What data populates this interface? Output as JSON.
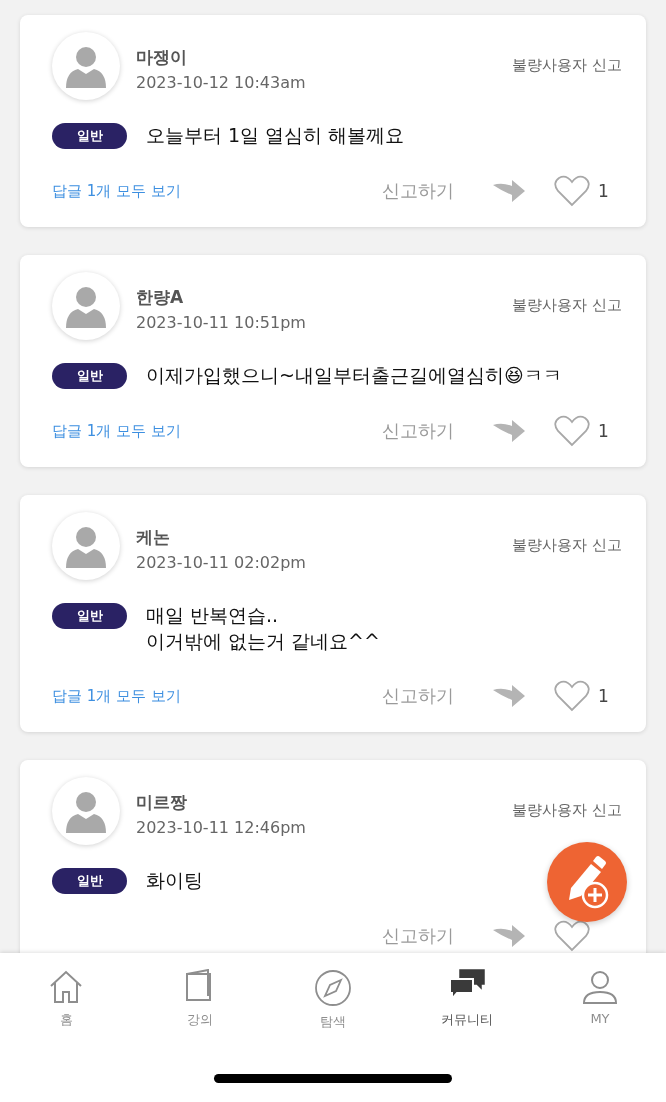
{
  "posts": [
    {
      "author": "마쟁이",
      "time": "2023-10-12 10:43am",
      "report_user": "불량사용자 신고",
      "category": "일반",
      "text": "오늘부터 1일 열심히 해볼께요",
      "replies_link": "답글 1개 모두 보기",
      "report": "신고하기",
      "liked": false,
      "like_count": "1"
    },
    {
      "author": "한량A",
      "time": "2023-10-11 10:51pm",
      "report_user": "불량사용자 신고",
      "category": "일반",
      "text": "이제가입했으니~내일부터출근길에열심히😆ㅋㅋ",
      "replies_link": "답글 1개 모두 보기",
      "report": "신고하기",
      "liked": false,
      "like_count": "1"
    },
    {
      "author": "케논",
      "time": "2023-10-11 02:02pm",
      "report_user": "불량사용자 신고",
      "category": "일반",
      "text": "매일 반복연습..\n이거밖에 없는거 같네요^^",
      "replies_link": "답글 1개 모두 보기",
      "report": "신고하기",
      "liked": false,
      "like_count": "1"
    },
    {
      "author": "미르짱",
      "time": "2023-10-11 12:46pm",
      "report_user": "불량사용자 신고",
      "category": "일반",
      "text": "화이팅",
      "report": "신고하기",
      "liked": false
    }
  ],
  "nav": [
    {
      "kind": "home",
      "label": "홈",
      "selected": false
    },
    {
      "kind": "lecture",
      "label": "강의",
      "selected": false
    },
    {
      "kind": "explore",
      "label": "탐색",
      "selected": false
    },
    {
      "kind": "community",
      "label": "커뮤니티",
      "selected": true
    },
    {
      "kind": "my",
      "label": "MY",
      "selected": false
    }
  ]
}
